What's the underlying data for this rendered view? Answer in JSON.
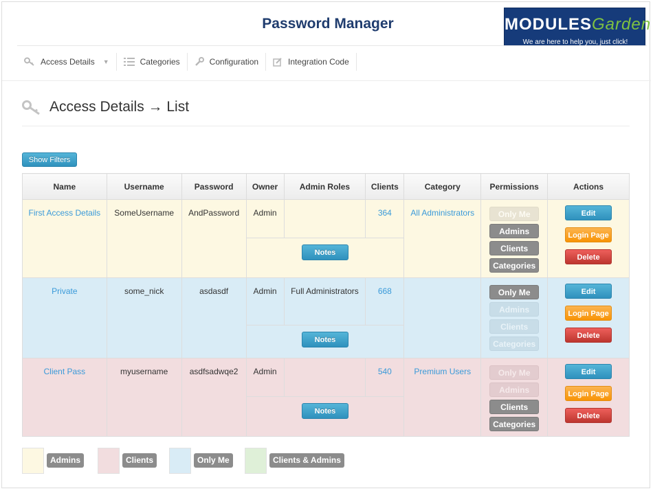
{
  "header": {
    "app_title": "Password Manager",
    "logo_word_main": "MODULES",
    "logo_word_accent": "Garden",
    "logo_tagline": "We are here to help you, just click!"
  },
  "nav": [
    {
      "label": "Access Details",
      "icon": "key-icon",
      "has_dropdown": true
    },
    {
      "label": "Categories",
      "icon": "list-icon"
    },
    {
      "label": "Configuration",
      "icon": "wrench-icon"
    },
    {
      "label": "Integration Code",
      "icon": "edit-icon"
    }
  ],
  "page": {
    "title": "Access Details → List",
    "show_filters_label": "Show Filters"
  },
  "table": {
    "columns": [
      "Name",
      "Username",
      "Password",
      "Owner",
      "Admin Roles",
      "Clients",
      "Category",
      "Permissions",
      "Actions"
    ],
    "rows": [
      {
        "name": "First Access Details",
        "username": "SomeUsername",
        "password": "AndPassword",
        "owner": "Admin",
        "admin_roles": "",
        "clients": "364",
        "category": "All Administrators",
        "notes_label": "Notes",
        "permissions": [
          {
            "label": "Only Me",
            "active": false
          },
          {
            "label": "Admins",
            "active": true
          },
          {
            "label": "Clients",
            "active": true
          },
          {
            "label": "Categories",
            "active": true
          }
        ]
      },
      {
        "name": "Private",
        "username": "some_nick",
        "password": "asdasdf",
        "owner": "Admin",
        "admin_roles": "Full Administrators",
        "clients": "668",
        "category": "",
        "notes_label": "Notes",
        "permissions": [
          {
            "label": "Only Me",
            "active": true
          },
          {
            "label": "Admins",
            "active": false
          },
          {
            "label": "Clients",
            "active": false
          },
          {
            "label": "Categories",
            "active": false
          }
        ]
      },
      {
        "name": "Client Pass",
        "username": "myusername",
        "password": "asdfsadwqe2",
        "owner": "Admin",
        "admin_roles": "",
        "clients": "540",
        "category": "Premium Users",
        "notes_label": "Notes",
        "permissions": [
          {
            "label": "Only Me",
            "active": false
          },
          {
            "label": "Admins",
            "active": false
          },
          {
            "label": "Clients",
            "active": true
          },
          {
            "label": "Categories",
            "active": true
          }
        ]
      }
    ],
    "actions": {
      "edit": "Edit",
      "login": "Login Page",
      "delete": "Delete"
    }
  },
  "legend": [
    {
      "label": "Admins",
      "color": "#fdf8e2"
    },
    {
      "label": "Clients",
      "color": "#f2dddf"
    },
    {
      "label": "Only Me",
      "color": "#d9ecf6"
    },
    {
      "label": "Clients & Admins",
      "color": "#dff0d8"
    }
  ],
  "colors": {
    "title": "#1f3c6e",
    "link": "#3a9ad9",
    "primary_button": "#2f91bd",
    "warning_button": "#f89406",
    "danger_button": "#bd362f"
  }
}
